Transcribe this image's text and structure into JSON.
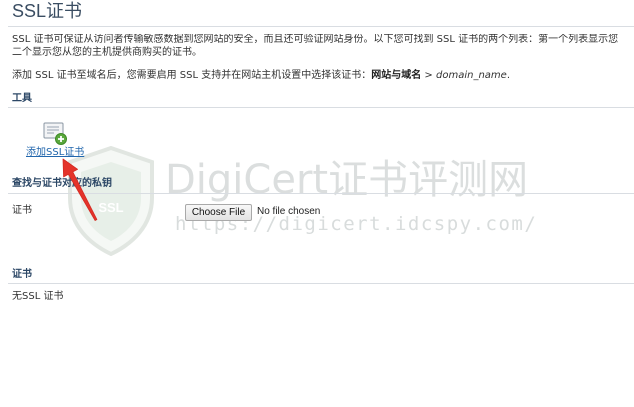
{
  "page": {
    "title": "SSL证书"
  },
  "intro": {
    "line1": "SSL 证书可保证从访问者传输敏感数据到您网站的安全，而且还可验证网站身份。以下您可找到 SSL 证书的两个列表：第一个列表显示您",
    "line2": "二个显示您从您的主机提供商购买的证书。",
    "hint": {
      "prefix": "添加 SSL 证书至域名后，您需要启用 SSL 支持并在网站主机设置中选择该证书：",
      "path": "网站与域名",
      "separator": " > ",
      "domain": "domain_name",
      "suffix": "."
    }
  },
  "tools": {
    "heading": "工具",
    "add_ssl_label": "添加SSL证书",
    "add_ssl_icon": "certificate-add-icon"
  },
  "private_key": {
    "heading": "查找与证书对应的私钥",
    "field_label": "证书",
    "file_button": "Choose File",
    "file_status": "No file chosen"
  },
  "certificates": {
    "heading": "证书",
    "empty_text": "无SSL 证书"
  },
  "annotation": {
    "arrow_icon": "red-arrow",
    "arrow_color": "#e4332a"
  },
  "watermark": {
    "logo_icon": "shield-logo",
    "logo_text": "SSL",
    "brand": "DigiCert证书评测网",
    "url": "https://digicert.idcspy.com/"
  },
  "colors": {
    "title": "#3a4d62",
    "heading": "#2c4766",
    "link": "#2166ad",
    "rule": "#d9dde2",
    "text": "#333333",
    "watermark": "#cfd4d4"
  }
}
